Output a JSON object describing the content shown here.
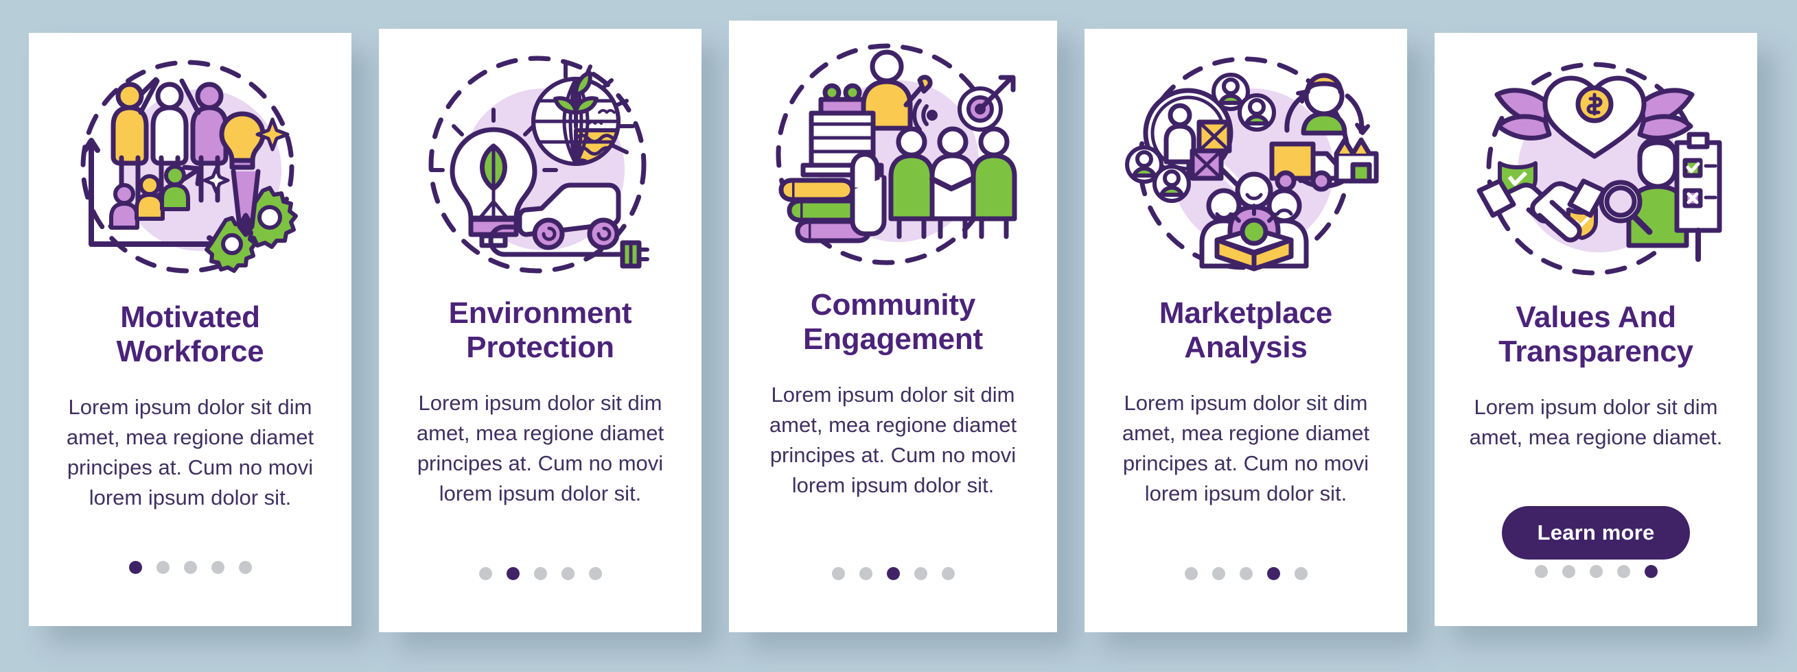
{
  "theme": {
    "background": "#b7cdd8",
    "card_bg": "#ffffff",
    "title_color": "#4b2379",
    "body_color": "#3f3060",
    "accent": "#3f2366",
    "dot_inactive": "#c6c8cc",
    "dot_active": "#3f2366",
    "illo_purple": "#3f2366",
    "illo_lilac": "#c98fd8",
    "illo_yellow": "#fac94f",
    "illo_green": "#7ec242",
    "illo_blob": "#ead7f2"
  },
  "cards": [
    {
      "id": "motivated-workforce",
      "illustration": "people-growth-chart-idea",
      "title": "Motivated\nWorkforce",
      "body": "Lorem ipsum dolor sit dim amet, mea regione diamet principes at. Cum no movi lorem ipsum dolor sit.",
      "dots": {
        "count": 5,
        "active_index": 0
      },
      "cta": null
    },
    {
      "id": "environment-protection",
      "illustration": "eco-bulb-globe-car",
      "title": "Environment\nProtection",
      "body": "Lorem ipsum dolor sit dim amet, mea regione diamet principes at. Cum no movi lorem ipsum dolor sit.",
      "dots": {
        "count": 5,
        "active_index": 1
      },
      "cta": null
    },
    {
      "id": "community-engagement",
      "illustration": "speaker-handshake-hands",
      "title": "Community\nEngagement",
      "body": "Lorem ipsum dolor sit dim amet, mea regione diamet principes at. Cum no movi lorem ipsum dolor sit.",
      "dots": {
        "count": 5,
        "active_index": 2
      },
      "cta": null
    },
    {
      "id": "marketplace-analysis",
      "illustration": "magnifier-users-delivery",
      "title": "Marketplace\nAnalysis",
      "body": "Lorem ipsum dolor sit dim amet, mea regione diamet principes at. Cum no movi lorem ipsum dolor sit.",
      "dots": {
        "count": 5,
        "active_index": 3
      },
      "cta": null
    },
    {
      "id": "values-and-transparency",
      "illustration": "winged-heart-handshake-checklist",
      "title": "Values And\nTransparency",
      "body": "Lorem ipsum dolor sit dim amet, mea regione diamet.",
      "dots": {
        "count": 5,
        "active_index": 4
      },
      "cta": "Learn more"
    }
  ]
}
